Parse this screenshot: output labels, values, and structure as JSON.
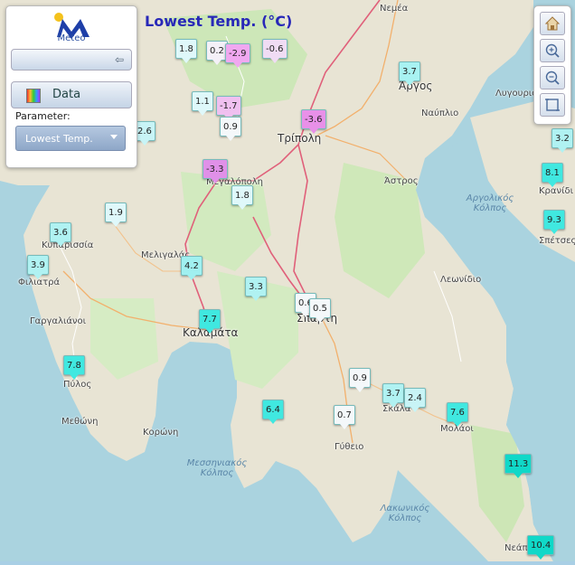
{
  "title": "Lowest Temp. (°C)",
  "logo": {
    "text": "Meteo"
  },
  "panel": {
    "data_label": "Data",
    "parameter_label": "Parameter:",
    "parameter_value": "Lowest Temp."
  },
  "toolbar": {
    "icons": [
      "home-icon",
      "zoom-in-icon",
      "zoom-out-icon",
      "fullscreen-icon"
    ]
  },
  "places": {
    "nemea": "Νεμέα",
    "argos": "Άργος",
    "lygourio": "Λυγουριό",
    "nafplio": "Ναύπλιο",
    "tripoli": "Τρίπολη",
    "astros": "Άστρος",
    "megalopoli": "Μεγαλόπολη",
    "melligalas": "Μελιγαλάς",
    "kyparissia": "Κυπαρισσία",
    "filiatra": "Φιλιατρά",
    "gargalianoi": "Γαργαλιάνοι",
    "kalamata": "Καλαμάτα",
    "pylos": "Πύλος",
    "methoni": "Μεθώνη",
    "koroni": "Κορώνη",
    "leonidio": "Λεωνίδιο",
    "sparti": "Σπάρτη",
    "skala": "Σκάλα",
    "molaoi": "Μολάοι",
    "gytheio": "Γύθειο",
    "kranidi": "Κρανίδι",
    "spetses": "Σπέτσες",
    "neapoli": "Νεάπ",
    "argolic_gulf": "Αργολικός Κόλπος",
    "messinian_gulf": "Μεσσηνιακός Κόλπος",
    "laconian_gulf": "Λακωνικός Κόλπος"
  },
  "markers": [
    "1.8",
    "0.2",
    "-2.9",
    "-0.6",
    "3.7",
    "1.1",
    "-1.7",
    "0.9",
    "-3.6",
    "2.6",
    "3.2",
    "-3.3",
    "1.8",
    "8.1",
    "1.9",
    "9.3",
    "3.6",
    "3.9",
    "4.2",
    "3.3",
    "0.6",
    "0.5",
    "7.7",
    "7.8",
    "0.9",
    "3.7",
    "2.4",
    "7.6",
    "6.4",
    "0.7",
    "11.3",
    "10.4"
  ],
  "colors": {
    "cold": "#f0a8f0",
    "cool": "#f0dcf4",
    "mild": "#dff8fa",
    "warm": "#a8f2f2",
    "hot": "#40e8e0",
    "title": "#2828b8"
  }
}
